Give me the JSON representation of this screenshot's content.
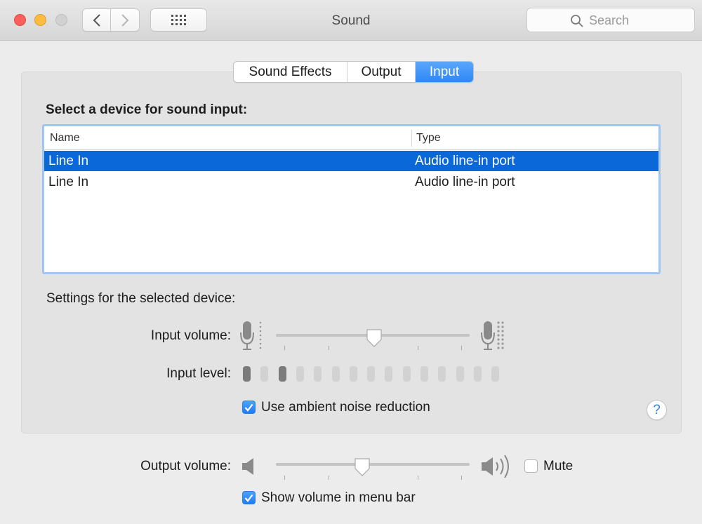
{
  "window": {
    "title": "Sound",
    "search_placeholder": "Search"
  },
  "tabs": [
    {
      "label": "Sound Effects",
      "active": false
    },
    {
      "label": "Output",
      "active": false
    },
    {
      "label": "Input",
      "active": true
    }
  ],
  "input": {
    "heading": "Select a device for sound input:",
    "columns": {
      "name": "Name",
      "type": "Type"
    },
    "devices": [
      {
        "name": "Line In",
        "type": "Audio line-in port",
        "selected": true
      },
      {
        "name": "Line In",
        "type": "Audio line-in port",
        "selected": false
      }
    ],
    "settings_heading": "Settings for the selected device:",
    "input_volume_label": "Input volume:",
    "input_volume_percent": 51,
    "input_level_label": "Input level:",
    "input_level_segments": 15,
    "input_level_active": [
      0,
      2
    ],
    "ambient_noise_label": "Use ambient noise reduction",
    "ambient_noise_checked": true,
    "help_label": "?"
  },
  "output": {
    "volume_label": "Output volume:",
    "volume_percent": 45,
    "mute_label": "Mute",
    "mute_checked": false,
    "show_volume_label": "Show volume in menu bar",
    "show_volume_checked": true
  },
  "colors": {
    "accent": "#2f87f7",
    "selection": "#0b68d9",
    "close": "#fc605c",
    "minimize": "#fdbc40"
  },
  "icons": [
    "chevron-left-icon",
    "chevron-right-icon",
    "grid-icon",
    "search-icon",
    "microphone-icon",
    "speaker-icon",
    "speaker-loud-icon",
    "checkmark-icon"
  ]
}
